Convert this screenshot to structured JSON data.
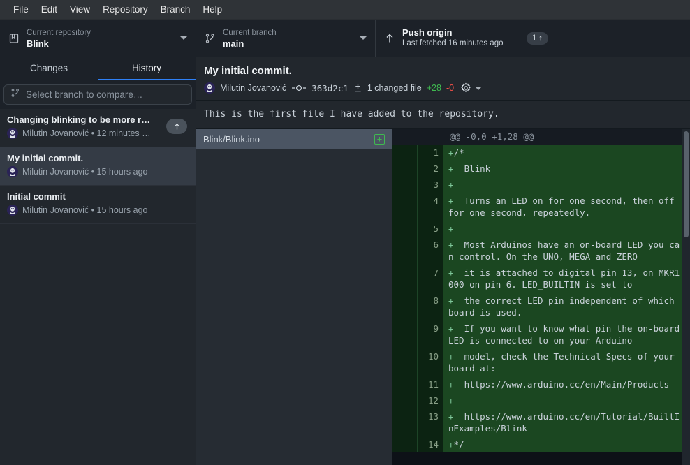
{
  "menu": {
    "items": [
      "File",
      "Edit",
      "View",
      "Repository",
      "Branch",
      "Help"
    ]
  },
  "toolbar": {
    "repository": {
      "label": "Current repository",
      "value": "Blink",
      "icon": "repo-icon"
    },
    "branch": {
      "label": "Current branch",
      "value": "main",
      "icon": "branch-icon"
    },
    "push": {
      "title": "Push origin",
      "subtitle": "Last fetched 16 minutes ago",
      "badge_count": "1",
      "badge_arrow": "↑",
      "icon": "upload-arrow-icon"
    }
  },
  "sidebar": {
    "tabs": [
      {
        "label": "Changes",
        "active": false
      },
      {
        "label": "History",
        "active": true
      }
    ],
    "compare": {
      "placeholder": "Select branch to compare…",
      "icon": "branch-icon"
    },
    "commits": [
      {
        "title": "Changing blinking to be more r…",
        "byline": "Milutin Jovanović • 12 minutes …",
        "selected": false,
        "unpushed": true
      },
      {
        "title": "My initial commit.",
        "byline": "Milutin Jovanović • 15 hours ago",
        "selected": true,
        "unpushed": false
      },
      {
        "title": "Initial commit",
        "byline": "Milutin Jovanović • 15 hours ago",
        "selected": false,
        "unpushed": false
      }
    ]
  },
  "commit_detail": {
    "title": "My initial commit.",
    "author": "Milutin Jovanović",
    "sha": "363d2c1",
    "changed_files": "1 changed file",
    "additions": "+28",
    "deletions": "-0",
    "description": "This is the first file I have added to the repository.",
    "settings_icon": "gear-icon"
  },
  "files": [
    {
      "name": "Blink/Blink.ino",
      "status": "+",
      "selected": true
    }
  ],
  "diff": {
    "hunk_header": "@@ -0,0 +1,28 @@",
    "lines": [
      {
        "num": "1",
        "sign": "+",
        "text": "/*"
      },
      {
        "num": "2",
        "sign": "+",
        "text": "  Blink"
      },
      {
        "num": "3",
        "sign": "+",
        "text": ""
      },
      {
        "num": "4",
        "sign": "+",
        "text": "  Turns an LED on for one second, then off for one second, repeatedly."
      },
      {
        "num": "5",
        "sign": "+",
        "text": ""
      },
      {
        "num": "6",
        "sign": "+",
        "text": "  Most Arduinos have an on-board LED you can control. On the UNO, MEGA and ZERO"
      },
      {
        "num": "7",
        "sign": "+",
        "text": "  it is attached to digital pin 13, on MKR1000 on pin 6. LED_BUILTIN is set to"
      },
      {
        "num": "8",
        "sign": "+",
        "text": "  the correct LED pin independent of which board is used."
      },
      {
        "num": "9",
        "sign": "+",
        "text": "  If you want to know what pin the on-board LED is connected to on your Arduino"
      },
      {
        "num": "10",
        "sign": "+",
        "text": "  model, check the Technical Specs of your board at:"
      },
      {
        "num": "11",
        "sign": "+",
        "text": "  https://www.arduino.cc/en/Main/Products"
      },
      {
        "num": "12",
        "sign": "+",
        "text": ""
      },
      {
        "num": "13",
        "sign": "+",
        "text": "  https://www.arduino.cc/en/Tutorial/BuiltInExamples/Blink"
      },
      {
        "num": "14",
        "sign": "+",
        "text": "*/"
      }
    ]
  },
  "colors": {
    "accent": "#2f81f7",
    "addition": "#3fb950",
    "deletion": "#f85149",
    "diff_add_bg": "#1b4721",
    "panel_bg": "#22272d",
    "toolbar_bg": "#1c2128"
  }
}
